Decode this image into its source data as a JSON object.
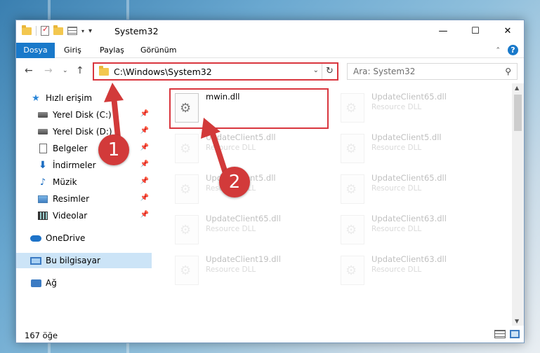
{
  "window": {
    "title": "System32",
    "controls": {
      "minimize": "—",
      "maximize": "☐",
      "close": "✕"
    }
  },
  "ribbon": {
    "tabs": [
      "Dosya",
      "Giriş",
      "Paylaş",
      "Görünüm"
    ],
    "help": "?"
  },
  "address": {
    "path": "C:\\Windows\\System32",
    "refresh": "↻",
    "dropdown": "⌄"
  },
  "search": {
    "placeholder": "Ara: System32"
  },
  "nav": {
    "items": [
      {
        "label": "Hızlı erişim",
        "icon": "quick-access-star-icon"
      },
      {
        "label": "Yerel Disk (C:)",
        "icon": "disk-icon",
        "pinned": true
      },
      {
        "label": "Yerel Disk (D:)",
        "icon": "disk-icon",
        "pinned": true
      },
      {
        "label": "Belgeler",
        "icon": "documents-icon",
        "pinned": true
      },
      {
        "label": "İndirmeler",
        "icon": "downloads-icon",
        "pinned": true
      },
      {
        "label": "Müzik",
        "icon": "music-icon",
        "pinned": true
      },
      {
        "label": "Resimler",
        "icon": "pictures-icon",
        "pinned": true
      },
      {
        "label": "Videolar",
        "icon": "videos-icon",
        "pinned": true
      },
      {
        "label": "OneDrive",
        "icon": "onedrive-cloud-icon"
      },
      {
        "label": "Bu bilgisayar",
        "icon": "this-pc-icon",
        "selected": true
      },
      {
        "label": "Ağ",
        "icon": "network-icon"
      }
    ]
  },
  "files": [
    {
      "name": "mwin.dll",
      "type": "",
      "highlighted": true
    },
    {
      "name": "UpdateClient65.dll",
      "type": "Resource DLL"
    },
    {
      "name": "UpdateClient5.dll",
      "type": "Resource DLL"
    },
    {
      "name": "UpdateClient5.dll",
      "type": "Resource DLL"
    },
    {
      "name": "UpdateClient5.dll",
      "type": "Resource DLL"
    },
    {
      "name": "UpdateClient65.dll",
      "type": "Resource DLL"
    },
    {
      "name": "UpdateClient65.dll",
      "type": "Resource DLL"
    },
    {
      "name": "UpdateClient63.dll",
      "type": "Resource DLL"
    },
    {
      "name": "UpdateClient19.dll",
      "type": "Resource DLL"
    },
    {
      "name": "UpdateClient63.dll",
      "type": "Resource DLL"
    }
  ],
  "status": {
    "count": "167 öğe"
  },
  "callouts": [
    "1",
    "2"
  ],
  "colors": {
    "accent": "#1979ca",
    "highlight_red": "#d9363e",
    "callout_red": "#d23a3a",
    "selected_bg": "#cce4f7"
  }
}
